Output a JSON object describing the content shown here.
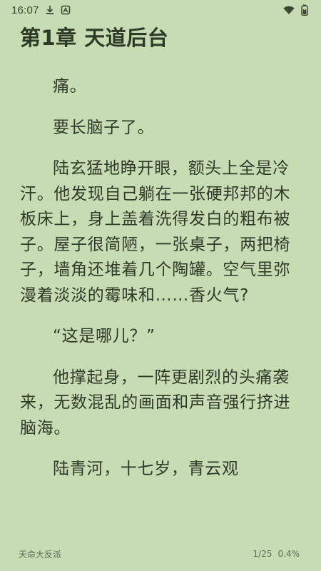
{
  "status_bar": {
    "time": "16:07",
    "icons": [
      "download-icon",
      "app-notification-icon",
      "wifi-icon",
      "battery-icon"
    ]
  },
  "reader": {
    "chapter_title": "第1章 天道后台",
    "paragraphs": [
      "痛。",
      "要长脑子了。",
      "陆玄猛地睁开眼，额头上全是冷汗。他发现自己躺在一张硬邦邦的木板床上，身上盖着洗得发白的粗布被子。屋子很简陋，一张桌子，两把椅子，墙角还堆着几个陶罐。空气里弥漫着淡淡的霉味和……香火气?",
      "“这是哪儿？”",
      "他撑起身，一阵更剧烈的头痛袭来，无数混乱的画面和声音强行挤进脑海。",
      "陆青河，十七岁，青云观"
    ]
  },
  "footer": {
    "book_title": "天命大反派",
    "page_indicator": "1/25",
    "progress_percent": "0.4%"
  },
  "colors": {
    "background": "#c7dcb3",
    "text": "#2f3a2a",
    "muted_text": "#5f6b57"
  }
}
